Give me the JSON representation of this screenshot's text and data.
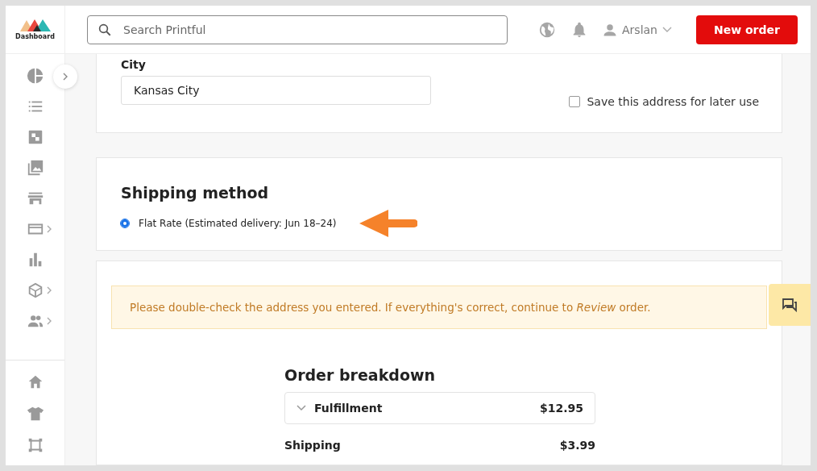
{
  "logo": {
    "label": "Dashboard"
  },
  "search": {
    "placeholder": "Search Printful"
  },
  "user": {
    "name": "Arslan"
  },
  "new_order_button": "New order",
  "sidebar": {
    "items": [
      {
        "has_submenu": false
      },
      {
        "has_submenu": false
      },
      {
        "has_submenu": false
      },
      {
        "has_submenu": false
      },
      {
        "has_submenu": false
      },
      {
        "has_submenu": true
      },
      {
        "has_submenu": false
      },
      {
        "has_submenu": true
      },
      {
        "has_submenu": true
      }
    ]
  },
  "address": {
    "city_label": "City",
    "city_value": "Kansas City",
    "save_address": {
      "label": "Save this address for later use",
      "checked": false
    }
  },
  "shipping": {
    "title": "Shipping method",
    "options": [
      {
        "label": "Flat Rate (Estimated delivery: Jun 18–24)",
        "selected": true
      }
    ]
  },
  "notice": "Please double-check the address you entered. If everything's correct, continue to *Review* order.",
  "order_breakdown": {
    "title": "Order breakdown",
    "rows": [
      {
        "kind": "collapsible",
        "label": "Fulfillment",
        "value": "$12.95",
        "expanded": false
      },
      {
        "kind": "plain",
        "label": "Shipping",
        "value": "$3.99"
      }
    ]
  }
}
